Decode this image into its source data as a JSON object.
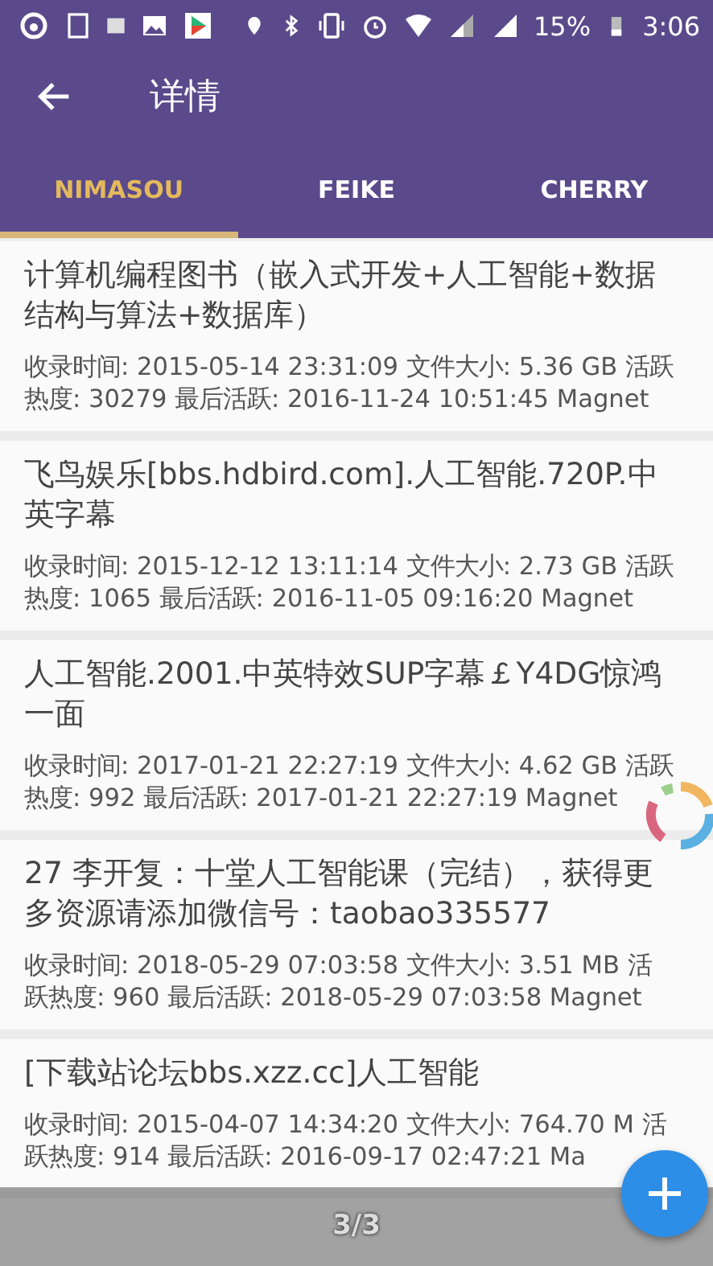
{
  "status_bar": {
    "battery": "15%",
    "time": "3:06"
  },
  "toolbar": {
    "title": "详情"
  },
  "tabs": [
    {
      "label": "NIMASOU",
      "selected": true
    },
    {
      "label": "FEIKE",
      "selected": false
    },
    {
      "label": "CHERRY",
      "selected": false
    }
  ],
  "results": [
    {
      "title": "计算机编程图书（嵌入式开发+人工智能+数据结构与算法+数据库）",
      "meta": "收录时间: 2015-05-14 23:31:09 文件大小: 5.36 GB 活跃热度: 30279 最后活跃: 2016-11-24 10:51:45 Magnet"
    },
    {
      "title": "飞鸟娱乐[bbs.hdbird.com].人工智能.720P.中英字幕",
      "meta": "收录时间: 2015-12-12 13:11:14 文件大小: 2.73 GB 活跃热度: 1065 最后活跃: 2016-11-05 09:16:20 Magnet"
    },
    {
      "title": "人工智能.2001.中英特效SUP字幕￡Y4DG惊鸿一面",
      "meta": "收录时间: 2017-01-21 22:27:19 文件大小: 4.62 GB 活跃热度: 992 最后活跃: 2017-01-21 22:27:19 Magnet"
    },
    {
      "title": "27 李开复：十堂人工智能课（完结），获得更多资源请添加微信号：taobao335577",
      "meta": "收录时间: 2018-05-29 07:03:58 文件大小: 3.51 MB 活跃热度: 960 最后活跃: 2018-05-29 07:03:58 Magnet"
    },
    {
      "title": "[下载站论坛bbs.xzz.cc]人工智能",
      "meta": "收录时间: 2015-04-07 14:34:20 文件大小: 764.70 M 活跃热度: 914 最后活跃: 2016-09-17 02:47:21 Ma"
    }
  ],
  "overlay": {
    "page": "3/3"
  }
}
